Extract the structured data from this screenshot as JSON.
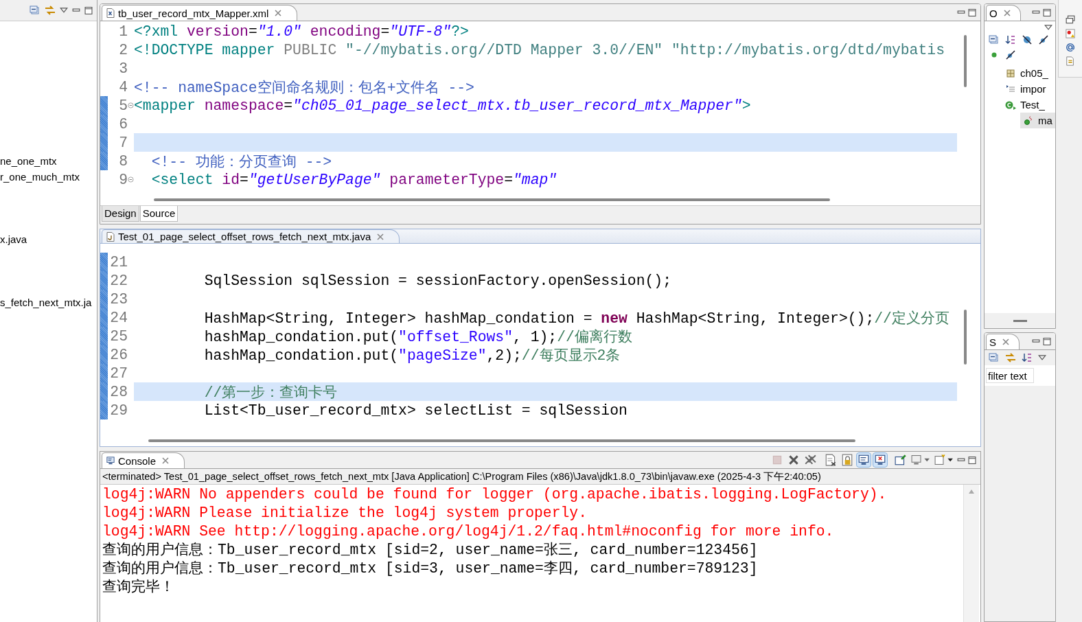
{
  "package_explorer": {
    "items": [
      {
        "label": "ne_one_mtx"
      },
      {
        "label": "r_one_much_mtx"
      },
      {
        "label": "x.java"
      },
      {
        "label": "s_fetch_next_mtx.ja"
      }
    ]
  },
  "xml_editor": {
    "tab": {
      "title": "tb_user_record_mtx_Mapper.xml"
    },
    "lines": [
      {
        "number": "1",
        "changed": false,
        "current": false,
        "foldable": false,
        "segments": [
          {
            "kind": "tag",
            "text": "<?xml"
          },
          {
            "kind": "attr",
            "text": " version"
          },
          {
            "kind": "plain",
            "text": "="
          },
          {
            "kind": "str",
            "text": "\"1.0\""
          },
          {
            "kind": "attr",
            "text": " encoding"
          },
          {
            "kind": "plain",
            "text": "="
          },
          {
            "kind": "str",
            "text": "\"UTF-8\""
          },
          {
            "kind": "tag",
            "text": "?>"
          }
        ]
      },
      {
        "number": "2",
        "changed": false,
        "current": false,
        "foldable": false,
        "segments": [
          {
            "kind": "tag",
            "text": "<!DOCTYPE mapper"
          },
          {
            "kind": "dtdkw",
            "text": " PUBLIC"
          },
          {
            "kind": "dtd",
            "text": " \"-//mybatis.org//DTD Mapper 3.0//EN\" \"http://mybatis.org/dtd/mybatis"
          }
        ]
      },
      {
        "number": "3",
        "changed": false,
        "current": false,
        "foldable": false
      },
      {
        "number": "4",
        "changed": false,
        "current": false,
        "foldable": false,
        "segments": [
          {
            "kind": "comment",
            "text": "<!-- nameSpace空间命名规则：包名+文件名 -->"
          }
        ]
      },
      {
        "number": "5",
        "changed": true,
        "current": false,
        "foldable": true,
        "segments": [
          {
            "kind": "tag",
            "text": "<mapper"
          },
          {
            "kind": "attr",
            "text": " namespace"
          },
          {
            "kind": "plain",
            "text": "="
          },
          {
            "kind": "str",
            "text": "\"ch05_01_page_select_mtx.tb_user_record_mtx_Mapper\""
          },
          {
            "kind": "tag",
            "text": ">"
          }
        ]
      },
      {
        "number": "6",
        "changed": true,
        "current": false,
        "foldable": false
      },
      {
        "number": "7",
        "changed": true,
        "current": true,
        "foldable": false
      },
      {
        "number": "8",
        "changed": true,
        "current": false,
        "foldable": false,
        "segments": [
          {
            "kind": "comment",
            "text": "  <!-- 功能：分页查询 -->"
          }
        ]
      },
      {
        "number": "9",
        "changed": false,
        "current": false,
        "foldable": true,
        "segments": [
          {
            "kind": "tag",
            "text": "  <select"
          },
          {
            "kind": "attr",
            "text": " id"
          },
          {
            "kind": "plain",
            "text": "="
          },
          {
            "kind": "str",
            "text": "\"getUserByPage\""
          },
          {
            "kind": "attr",
            "text": " parameterType"
          },
          {
            "kind": "plain",
            "text": "="
          },
          {
            "kind": "str",
            "text": "\"map\""
          }
        ]
      }
    ],
    "page_tabs": [
      {
        "label": "Design",
        "selected": false
      },
      {
        "label": "Source",
        "selected": true
      }
    ]
  },
  "java_editor": {
    "tab": {
      "title": "Test_01_page_select_offset_rows_fetch_next_mtx.java"
    },
    "lines": [
      {
        "number": "21",
        "changed": true,
        "current": false
      },
      {
        "number": "22",
        "changed": true,
        "current": false,
        "segments": [
          {
            "kind": "plain",
            "text": "        SqlSession sqlSession = sessionFactory.openSession();"
          }
        ]
      },
      {
        "number": "23",
        "changed": true,
        "current": false
      },
      {
        "number": "24",
        "changed": true,
        "current": false,
        "segments": [
          {
            "kind": "plain",
            "text": "        HashMap<String, Integer> hashMap_condation = "
          },
          {
            "kind": "kw",
            "text": "new"
          },
          {
            "kind": "plain",
            "text": " HashMap<String, Integer>();"
          },
          {
            "kind": "comment",
            "text": "//定义分页"
          }
        ]
      },
      {
        "number": "25",
        "changed": true,
        "current": false,
        "segments": [
          {
            "kind": "plain",
            "text": "        hashMap_condation.put("
          },
          {
            "kind": "str",
            "text": "\"offset_Rows\""
          },
          {
            "kind": "plain",
            "text": ", 1);"
          },
          {
            "kind": "comment",
            "text": "//偏离行数"
          }
        ]
      },
      {
        "number": "26",
        "changed": true,
        "current": false,
        "segments": [
          {
            "kind": "plain",
            "text": "        hashMap_condation.put("
          },
          {
            "kind": "str",
            "text": "\"pageSize\""
          },
          {
            "kind": "plain",
            "text": ",2);"
          },
          {
            "kind": "comment",
            "text": "//每页显示2条"
          }
        ]
      },
      {
        "number": "27",
        "changed": true,
        "current": false
      },
      {
        "number": "28",
        "changed": true,
        "current": true,
        "segments": [
          {
            "kind": "comment",
            "text": "        //第一步：查询卡号"
          }
        ]
      },
      {
        "number": "29",
        "changed": true,
        "current": false,
        "segments": [
          {
            "kind": "plain",
            "text": "        List<Tb_user_record_mtx> selectList = sqlSession"
          }
        ]
      }
    ]
  },
  "console": {
    "tab": {
      "title": "Console"
    },
    "toolbar": [
      {
        "kind": "stop",
        "disabled": true
      },
      {
        "kind": "remove",
        "disabled": false
      },
      {
        "kind": "remove-all",
        "disabled": false
      },
      {
        "kind": "clear",
        "disabled": false
      },
      {
        "kind": "lock",
        "disabled": false
      },
      {
        "kind": "stdout",
        "on": true
      },
      {
        "kind": "stderr",
        "on": true
      },
      {
        "kind": "pin",
        "disabled": false
      },
      {
        "kind": "display",
        "disabled": false
      },
      {
        "kind": "open",
        "disabled": false
      }
    ],
    "header": "<terminated> Test_01_page_select_offset_rows_fetch_next_mtx [Java Application] C:\\Program Files (x86)\\Java\\jdk1.8.0_73\\bin\\javaw.exe (2025-4-3 下午2:40:05)",
    "lines": [
      {
        "kind": "error",
        "text": "log4j:WARN No appenders could be found for logger (org.apache.ibatis.logging.LogFactory)."
      },
      {
        "kind": "error",
        "text": "log4j:WARN Please initialize the log4j system properly."
      },
      {
        "kind": "error",
        "text": "log4j:WARN See http://logging.apache.org/log4j/1.2/faq.html#noconfig for more info."
      },
      {
        "kind": "output",
        "text": "查询的用户信息：Tb_user_record_mtx [sid=2, user_name=张三, card_number=123456]"
      },
      {
        "kind": "output",
        "text": "查询的用户信息：Tb_user_record_mtx [sid=3, user_name=李四, card_number=789123]"
      },
      {
        "kind": "output",
        "text": "查询完毕！"
      }
    ]
  },
  "outline": {
    "tab": {
      "title": "O"
    },
    "items": [
      {
        "kind": "package",
        "label": "ch05_",
        "selected": false
      },
      {
        "kind": "imports",
        "label": "impor",
        "selected": false
      },
      {
        "kind": "class",
        "label": "Test_",
        "selected": false,
        "children": [
          {
            "kind": "method",
            "label": "ma",
            "selected": true
          }
        ]
      }
    ]
  },
  "second_panel": {
    "tab": {
      "title": "S"
    },
    "filter": {
      "placeholder": "filter text"
    }
  }
}
